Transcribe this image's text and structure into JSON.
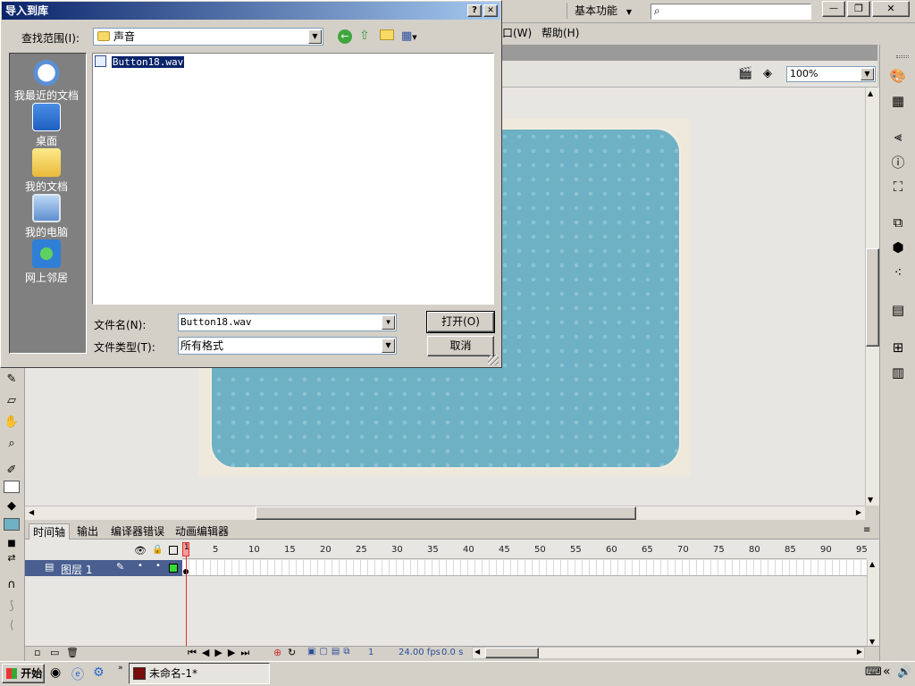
{
  "app_bar": {
    "workspace": "基本功能",
    "search_placeholder": "",
    "minimize": "—",
    "restore": "❐",
    "close": "✕"
  },
  "menu": {
    "partial": "口(W)",
    "help": "帮助(H)"
  },
  "stage_toolbar": {
    "zoom": "100%"
  },
  "dialog": {
    "title": "导入到库",
    "help_btn": "?",
    "close_btn": "✕",
    "look_in_label": "查找范围(I):",
    "look_in_value": "声音",
    "places": [
      {
        "label": "我最近的文档"
      },
      {
        "label": "桌面"
      },
      {
        "label": "我的文档"
      },
      {
        "label": "我的电脑"
      },
      {
        "label": "网上邻居"
      }
    ],
    "files": [
      {
        "name": "Button18.wav"
      }
    ],
    "filename_label": "文件名(N):",
    "filename_value": "Button18.wav",
    "filetype_label": "文件类型(T):",
    "filetype_value": "所有格式",
    "open_btn": "打开(O)",
    "cancel_btn": "取消"
  },
  "panel_tabs": [
    {
      "label": "时间轴"
    },
    {
      "label": "输出"
    },
    {
      "label": "编译器错误"
    },
    {
      "label": "动画编辑器"
    }
  ],
  "timeline": {
    "frame_numbers": [
      "1",
      "5",
      "10",
      "15",
      "20",
      "25",
      "30",
      "35",
      "40",
      "45",
      "50",
      "55",
      "60",
      "65",
      "70",
      "75",
      "80",
      "85",
      "90",
      "95"
    ],
    "layer_name": "图层 1",
    "current_frame": "1",
    "fps": "24.00 fps",
    "time": "0.0 s"
  },
  "taskbar": {
    "start": "开始",
    "task": "未命名-1*",
    "expand": "«"
  },
  "colors": {
    "stage_blue": "#6fb1c4",
    "title_blue": "#0a246a",
    "layer_highlight": "#4a5f8f",
    "playhead": "#e03030"
  }
}
